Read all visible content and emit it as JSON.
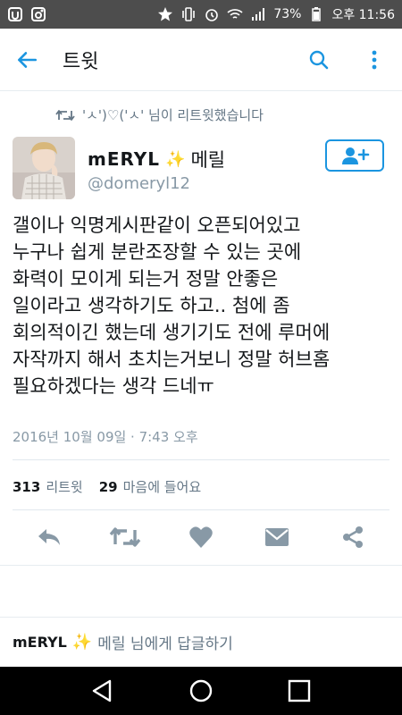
{
  "status_bar": {
    "battery_percent": "73%",
    "time": "오후 11:56"
  },
  "header": {
    "title": "트윗"
  },
  "retweet_context": {
    "text": "'ㅅ')♡('ㅅ' 님이 리트윗했습니다"
  },
  "tweet": {
    "author_logo": "mERYL",
    "author_name": "메릴",
    "author_handle": "@domeryl12",
    "text_lines": [
      "갤이나 익명게시판같이 오픈되어있고",
      "누구나 쉽게 분란조장할 수 있는 곳에",
      "화력이 모이게 되는거 정말 안좋은",
      "일이라고 생각하기도 하고.. 첨에 좀",
      "회의적이긴 했는데 생기기도 전에 루머에",
      "자작까지 해서 초치는거보니 정말 허브홈",
      "필요하겠다는 생각 드네ㅠ"
    ],
    "timestamp": "2016년 10월 09일 · 7:43 오후",
    "retweet_count": "313",
    "retweet_label": "리트윗",
    "like_count": "29",
    "like_label": "마음에 들어요"
  },
  "reply": {
    "logo": "mERYL",
    "prompt": "메릴 님에게 답글하기"
  },
  "colors": {
    "accent": "#1b95e0",
    "icon_gray": "#8899a6",
    "status_bar": "#4d4d4d",
    "nav_bar": "#000000"
  }
}
